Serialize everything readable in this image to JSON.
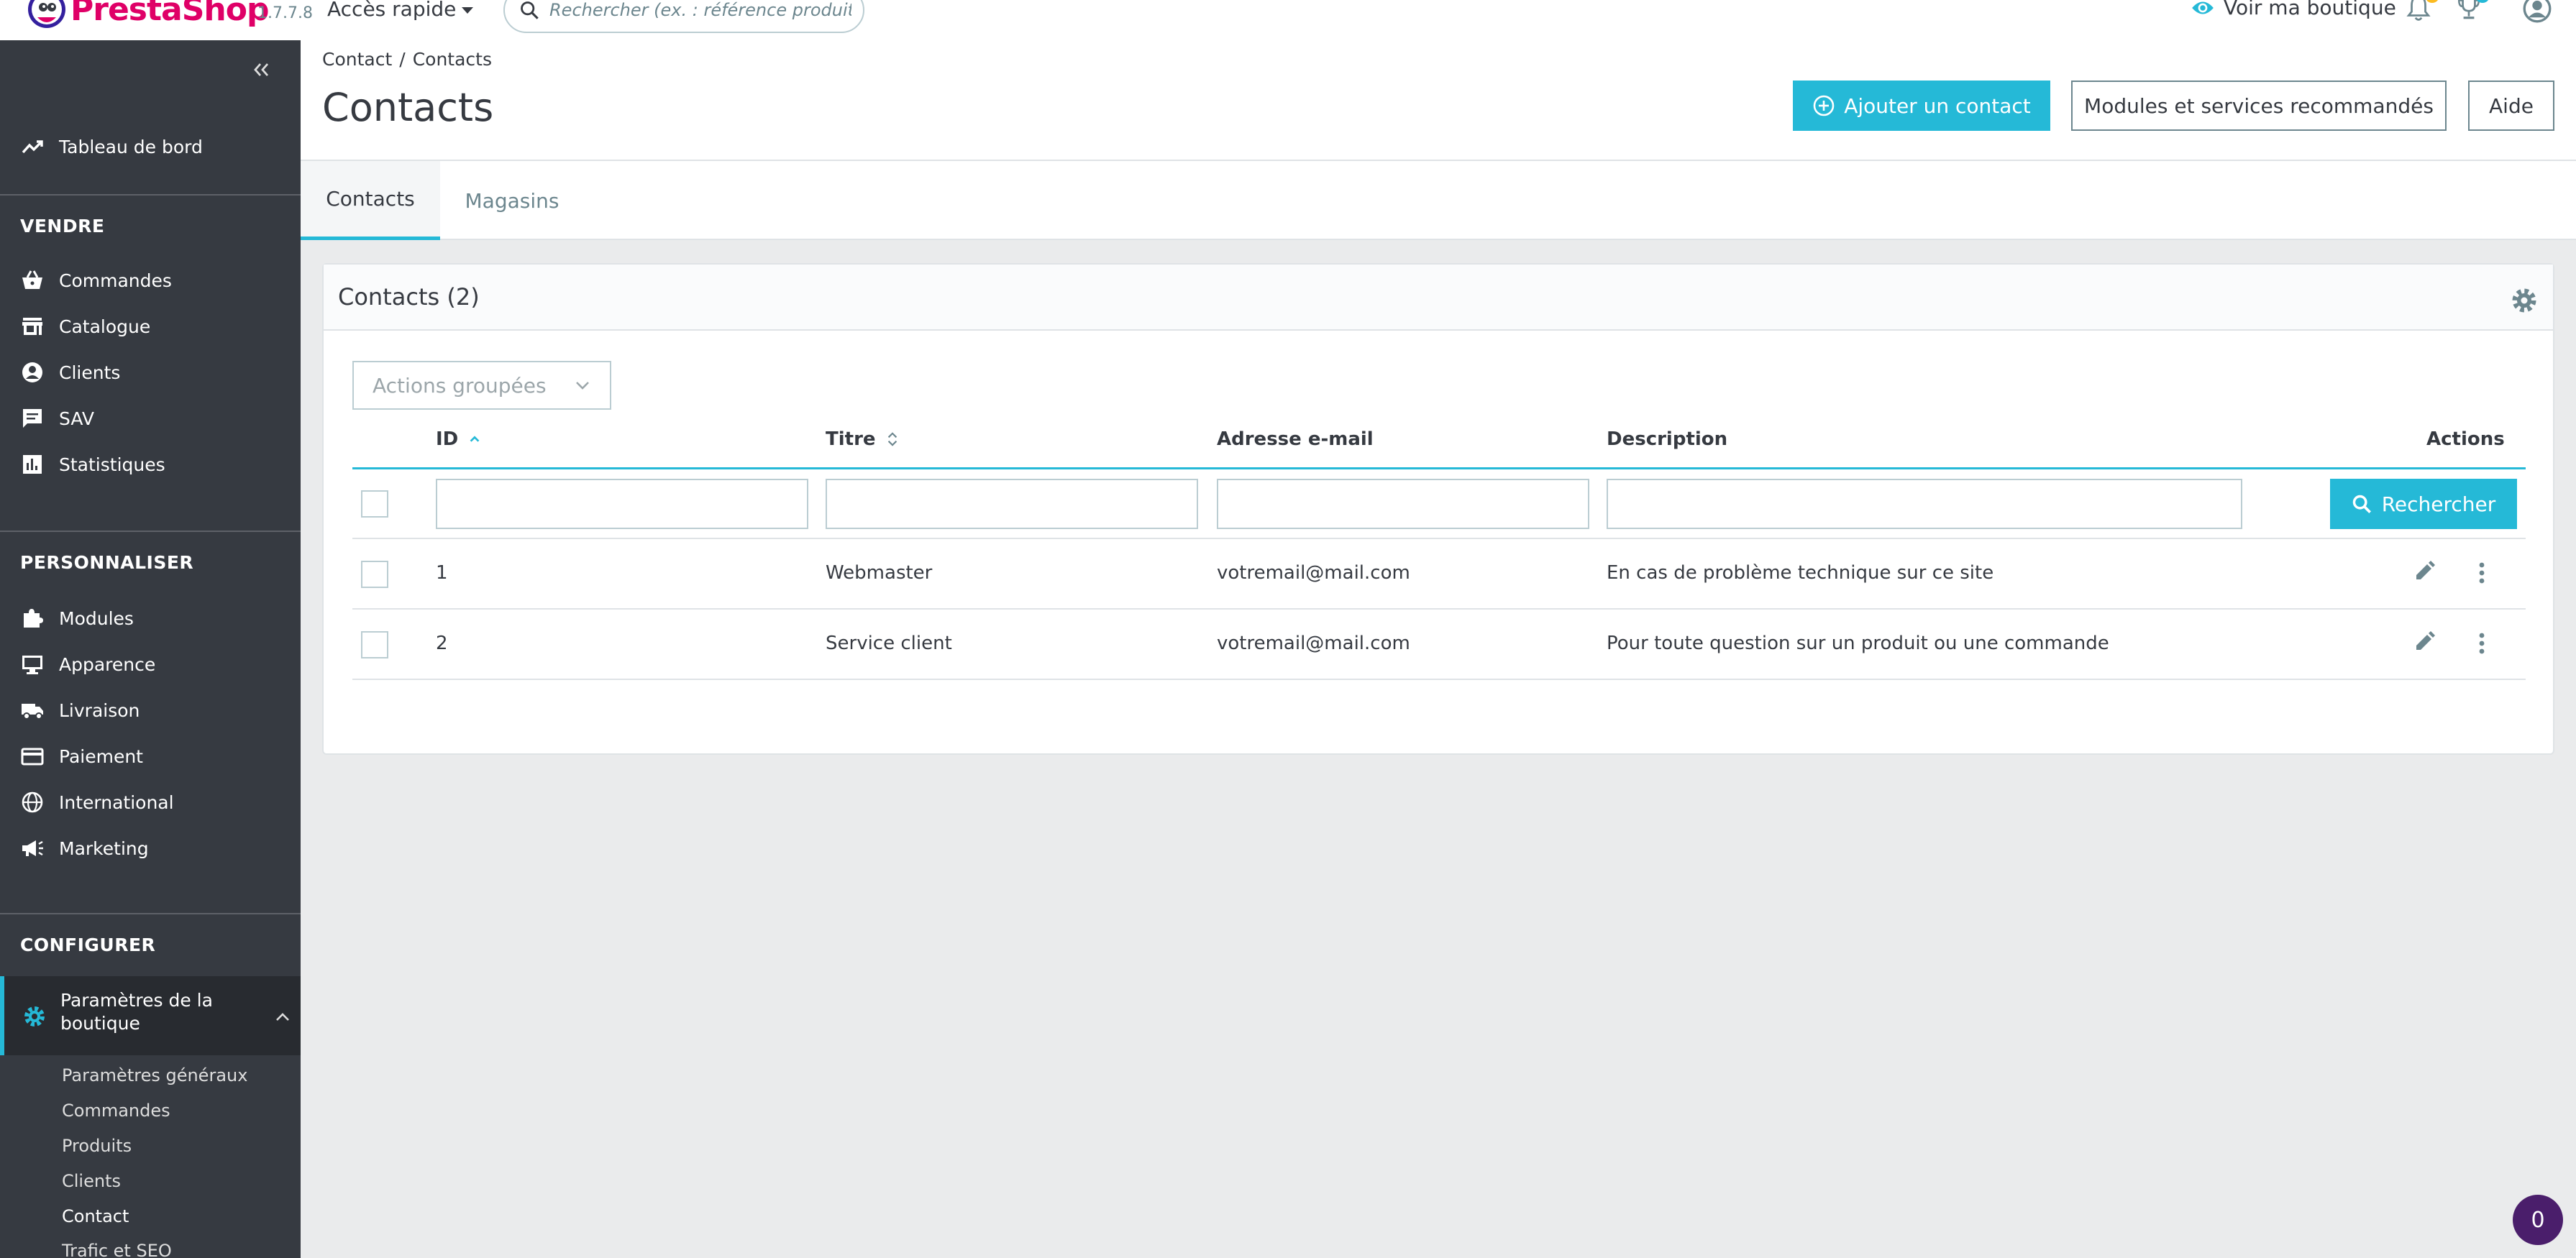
{
  "header": {
    "brand": "PrestaShop",
    "version": "1.7.7.8",
    "quick_access": "Accès rapide",
    "search_placeholder": "Rechercher (ex. : référence produit, nom",
    "view_shop": "Voir ma boutique",
    "colors": {
      "brand": "#df0067",
      "accent": "#25b9d7"
    },
    "icons": [
      "bell-icon",
      "trophy-icon",
      "user-icon"
    ]
  },
  "sidebar": {
    "dashboard": "Tableau de bord",
    "sections": {
      "sell": "VENDRE",
      "customize": "PERSONNALISER",
      "configure": "CONFIGURER"
    },
    "sell_items": [
      "Commandes",
      "Catalogue",
      "Clients",
      "SAV",
      "Statistiques"
    ],
    "customize_items": [
      "Modules",
      "Apparence",
      "Livraison",
      "Paiement",
      "International",
      "Marketing"
    ],
    "configure_active": "Paramètres de la boutique",
    "configure_sub": [
      "Paramètres généraux",
      "Commandes",
      "Produits",
      "Clients",
      "Contact",
      "Trafic et SEO"
    ],
    "current_sub": "Contact"
  },
  "page": {
    "breadcrumb": [
      "Contact",
      "Contacts"
    ],
    "title": "Contacts",
    "add_button": "Ajouter un contact",
    "modules_button": "Modules et services recommandés",
    "help_button": "Aide",
    "tabs": [
      "Contacts",
      "Magasins"
    ],
    "active_tab": "Contacts"
  },
  "card": {
    "title": "Contacts (2)",
    "bulk_actions": "Actions groupées",
    "columns": [
      "ID",
      "Titre",
      "Adresse e-mail",
      "Description",
      "Actions"
    ],
    "search_button": "Rechercher",
    "rows": [
      {
        "id": "1",
        "title": "Webmaster",
        "email": "votremail@mail.com",
        "description": "En cas de problème technique sur ce site"
      },
      {
        "id": "2",
        "title": "Service client",
        "email": "votremail@mail.com",
        "description": "Pour toute question sur un produit ou une commande"
      }
    ]
  },
  "bubble": {
    "count": "0"
  }
}
